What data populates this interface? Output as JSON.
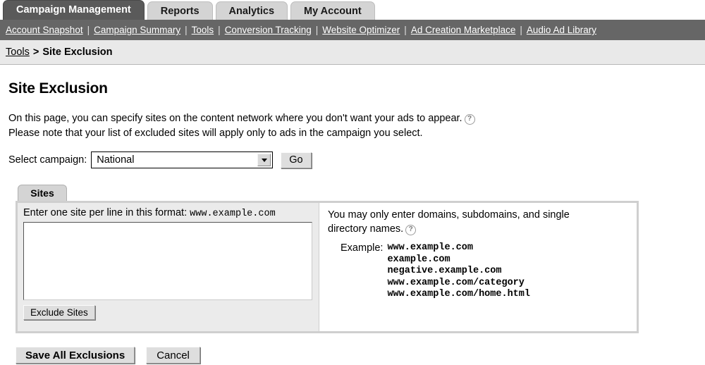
{
  "tabs": [
    {
      "label": "Campaign Management",
      "active": true
    },
    {
      "label": "Reports",
      "active": false
    },
    {
      "label": "Analytics",
      "active": false
    },
    {
      "label": "My Account",
      "active": false
    }
  ],
  "subnav": {
    "links": [
      "Account Snapshot",
      "Campaign Summary",
      "Tools",
      "Conversion Tracking",
      "Website Optimizer",
      "Ad Creation Marketplace",
      "Audio Ad Library"
    ],
    "separator": "|"
  },
  "breadcrumb": {
    "parent": "Tools",
    "separator": ">",
    "current": "Site Exclusion"
  },
  "page": {
    "title": "Site Exclusion",
    "intro_line1": "On this page, you can specify sites on the content network where you don't want your ads to appear.",
    "intro_line2": "Please note that your list of excluded sites will apply only to ads in the campaign you select.",
    "help_glyph": "?"
  },
  "campaign_select": {
    "label": "Select campaign:",
    "value": "National",
    "options": [
      "National"
    ],
    "go_label": "Go"
  },
  "sites_panel": {
    "tab_label": "Sites",
    "left": {
      "label_prefix": "Enter one site per line in this format:",
      "label_example": "www.example.com",
      "textarea_value": "",
      "textarea_placeholder": "",
      "exclude_button": "Exclude Sites"
    },
    "right": {
      "instructions": "You may only enter domains, subdomains, and single directory names.",
      "example_label": "Example:",
      "examples": [
        "www.example.com",
        "example.com",
        "negative.example.com",
        "www.example.com/category",
        "www.example.com/home.html"
      ]
    }
  },
  "footer": {
    "save_label": "Save All Exclusions",
    "cancel_label": "Cancel"
  },
  "colors": {
    "active_tab_bg": "#5a5a5a",
    "inactive_tab_bg": "#d4d4d4",
    "subnav_bg": "#666666",
    "breadcrumb_bg": "#e9e9e9",
    "panel_border": "#cfcfcf",
    "panel_left_bg": "#ebebeb"
  }
}
